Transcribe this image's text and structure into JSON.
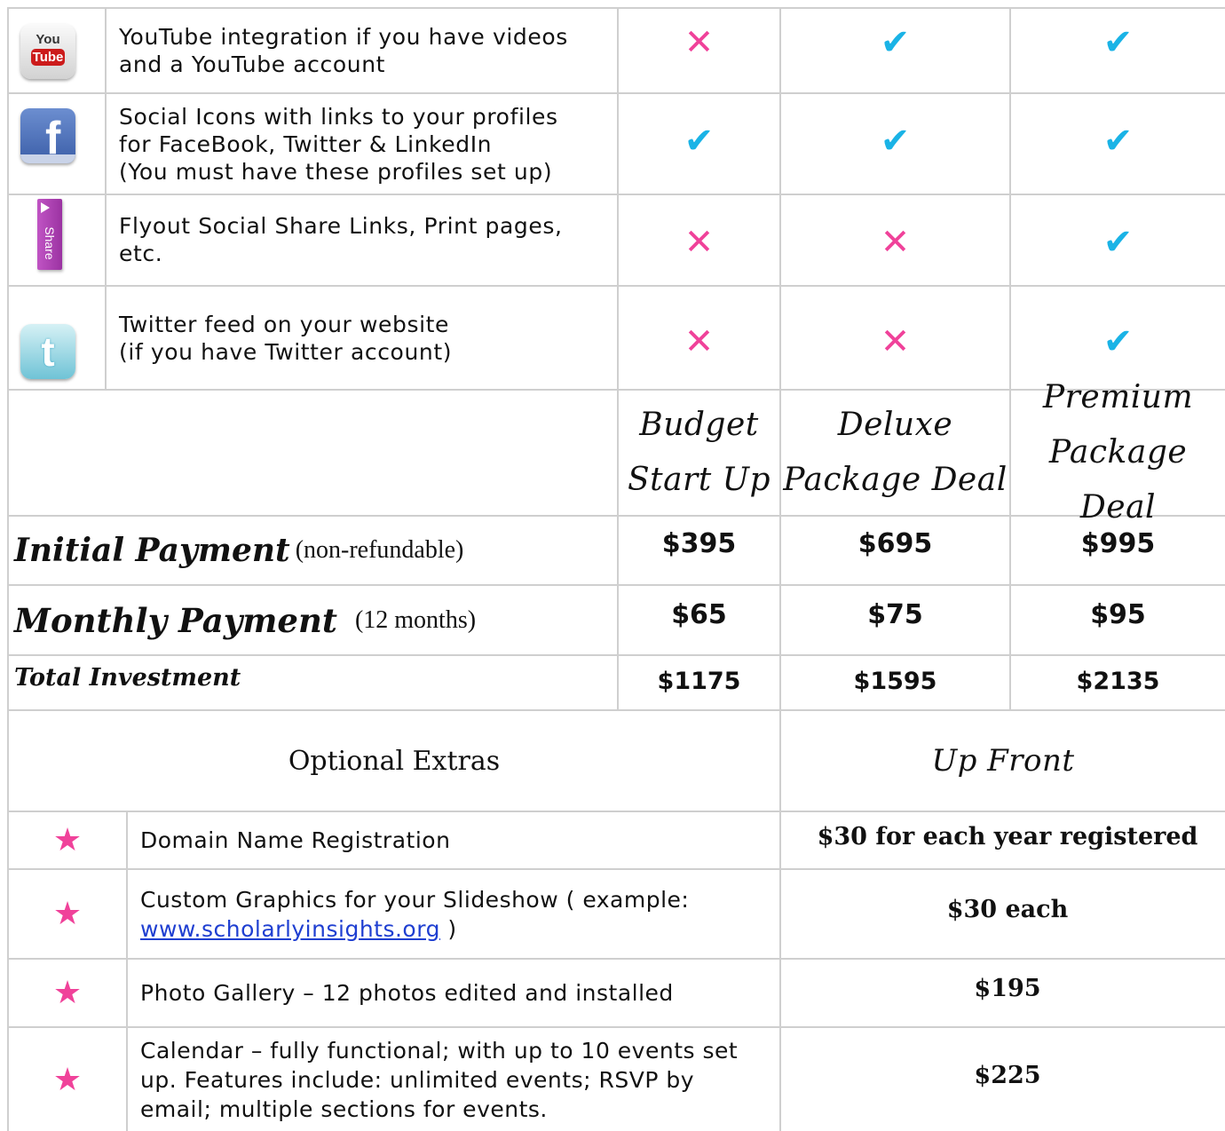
{
  "features": [
    {
      "icon": "youtube-icon",
      "icon_text_top": "You",
      "icon_text_bottom": "Tube",
      "lines": [
        "YouTube integration if you have videos",
        "and a YouTube account"
      ],
      "budget": "✕",
      "deluxe": "✔",
      "premium": "✔"
    },
    {
      "icon": "facebook-icon",
      "icon_text": "f",
      "lines": [
        "Social Icons with links to your profiles",
        "for FaceBook, Twitter & LinkedIn",
        "(You must have these profiles set up)"
      ],
      "budget": "✔",
      "deluxe": "✔",
      "premium": "✔"
    },
    {
      "icon": "share-icon",
      "icon_text": "Share",
      "lines": [
        "Flyout Social Share Links, Print pages,",
        "etc."
      ],
      "budget": "✕",
      "deluxe": "✕",
      "premium": "✔"
    },
    {
      "icon": "twitter-icon",
      "icon_text": "t",
      "lines": [
        "Twitter feed on your website",
        "(if you have Twitter account)"
      ],
      "budget": "✕",
      "deluxe": "✕",
      "premium": "✔"
    }
  ],
  "packages": {
    "budget": [
      "Budget",
      "Start Up"
    ],
    "deluxe": [
      "Deluxe",
      "Package Deal"
    ],
    "premium": [
      "Premium",
      "Package Deal"
    ]
  },
  "payments": {
    "initial": {
      "label": "Initial Payment",
      "note": "(non-refundable)",
      "budget": "$395",
      "deluxe": "$695",
      "premium": "$995"
    },
    "monthly": {
      "label": "Monthly Payment",
      "note": "(12 months)",
      "budget": "$65",
      "deluxe": "$75",
      "premium": "$95"
    },
    "total": {
      "label": "Total Investment",
      "budget": "$1175",
      "deluxe": "$1595",
      "premium": "$2135"
    }
  },
  "extras": {
    "heading": "Optional Extras",
    "price_heading": "Up Front",
    "star": "★",
    "items": [
      {
        "text": "Domain Name Registration",
        "price": "$30 for each year registered"
      },
      {
        "text_before": "Custom Graphics for your Slideshow ( example:",
        "link": "www.scholarlyinsights.org",
        "text_after": " )",
        "price": "$30 each"
      },
      {
        "text": "Photo Gallery – 12 photos edited and installed",
        "price": "$195"
      },
      {
        "lines": [
          "Calendar – fully functional; with up to 10 events set",
          "up. Features include: unlimited events; RSVP by",
          "email; multiple sections for events."
        ],
        "price": "$225"
      }
    ]
  }
}
